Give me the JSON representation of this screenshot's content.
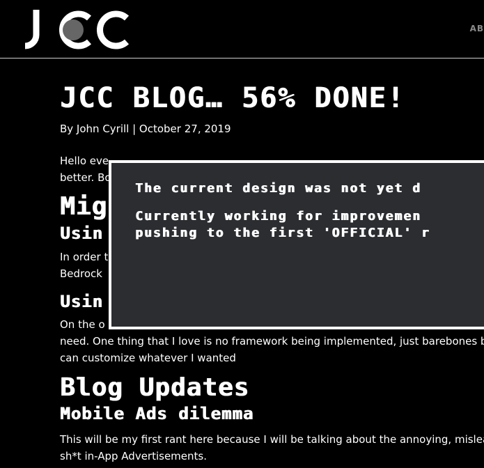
{
  "header": {
    "logo_text": "JCC",
    "nav_item": "AB"
  },
  "post": {
    "title": "JCC BLOG… 56% DONE!",
    "byline": "By John Cyrill | October 27, 2019",
    "intro_line1": "Hello eve",
    "intro_line2": "better. Bo",
    "section_migration": "Mig",
    "sub_using1": "Usin",
    "para_order_line1": "In order t",
    "para_order_line2": "Bedrock",
    "sub_using2": "Usin",
    "para_other_line1": "On the o",
    "para_other_line2": "need. One thing that I love is no framework being implemented, just barebones ba",
    "para_other_line3": "can customize whatever I wanted",
    "section_blog_updates": "Blog Updates",
    "sub_mobile_ads": "Mobile Ads dilemma",
    "para_rant_line1": "This will be my first rant here because I will be talking about the annoying, mislead",
    "para_rant_line2": "sh*t in-App Advertisements."
  },
  "modal": {
    "line1": "The current design was not yet d",
    "line2": "Currently working for improvemen",
    "line3": "pushing to the first 'OFFICIAL' r"
  },
  "colors": {
    "background": "#000000",
    "modal_background": "#2b2d31",
    "modal_border": "#ffffff",
    "header_rule": "#cfcfcf",
    "nav_text": "#8a8a8a"
  }
}
